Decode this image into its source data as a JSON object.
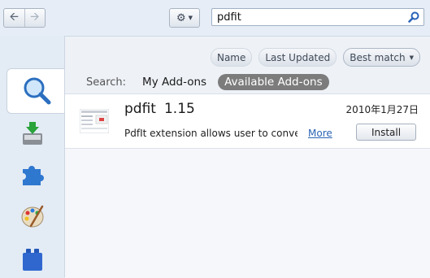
{
  "toolbar": {
    "back_icon": "back-arrow-icon",
    "forward_icon": "forward-arrow-icon",
    "tools_icon": "gear-icon",
    "search": {
      "value": "pdfit",
      "icon": "search-icon"
    }
  },
  "sidebar": {
    "categories": [
      {
        "icon": "get-addons-search-icon",
        "selected": true
      },
      {
        "icon": "download-tray-icon",
        "selected": false
      },
      {
        "icon": "puzzle-piece-icon",
        "selected": false
      },
      {
        "icon": "palette-icon",
        "selected": false
      },
      {
        "icon": "lego-brick-icon",
        "selected": false
      }
    ]
  },
  "sort": {
    "options": [
      "Name",
      "Last Updated",
      "Best match"
    ],
    "active": "Best match"
  },
  "scope": {
    "label": "Search:",
    "options": [
      "My Add-ons",
      "Available Add-ons"
    ],
    "active": "Available Add-ons"
  },
  "results": [
    {
      "name": "pdfit",
      "version": "1.15",
      "date": "2010年1月27日",
      "description": "PdfIt extension allows user to conve...",
      "more_label": "More",
      "install_label": "Install"
    }
  ],
  "colors": {
    "accent_link": "#2a64b5",
    "scope_active_bg": "#7c7c7c",
    "sidebar_bg": "#e3ebf5"
  }
}
